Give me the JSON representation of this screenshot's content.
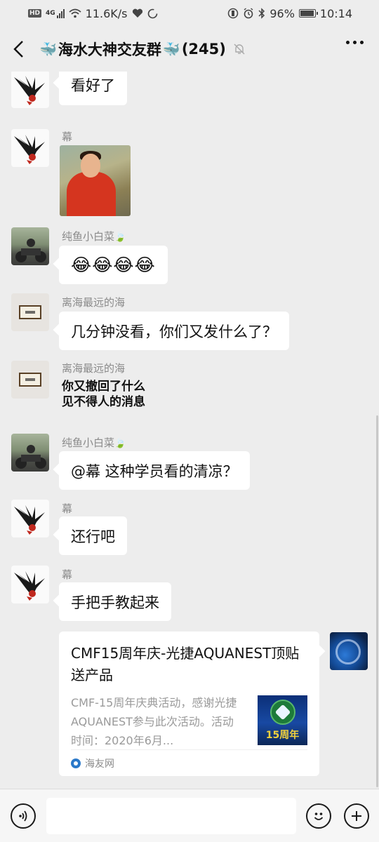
{
  "status_bar": {
    "hd": "HD",
    "network": "4G",
    "speed": "11.6K/s",
    "battery": "96%",
    "battery_level": 0.96,
    "time": "10:14"
  },
  "header": {
    "title": "海水大神交友群",
    "whale": "🐳",
    "count": "(245)"
  },
  "messages": [
    {
      "sender": "幕",
      "text": "看好了"
    },
    {
      "sender": "幕"
    },
    {
      "sender": "纯鱼小白菜",
      "leaf": "🍃",
      "emojis": "😂😂😂😂"
    },
    {
      "sender": "离海最远的海",
      "text": "几分钟没看，你们又发什么了？"
    },
    {
      "sender": "离海最远的海",
      "lines": [
        "你又撤回了什么",
        "见不得人的消息"
      ]
    },
    {
      "sender": "纯鱼小白菜",
      "leaf": "🍃",
      "text": "@幕  这种学员看的清凉？"
    },
    {
      "sender": "幕",
      "text": "还行吧"
    },
    {
      "sender": "幕",
      "text": "手把手教起来"
    }
  ],
  "link_card": {
    "title": "CMF15周年庆-光捷AQUANEST顶贴送产品",
    "description": "CMF-15周年庆典活动，感谢光捷AQUANEST参与此次活动。活动时间：2020年6月...",
    "thumb_label": "15周年",
    "source": "海友网"
  },
  "input": {
    "value": ""
  }
}
